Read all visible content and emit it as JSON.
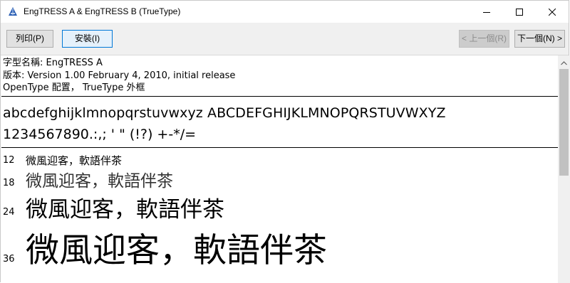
{
  "window": {
    "title": "EngTRESS A & EngTRESS B  (TrueType)",
    "icon": "font-file-icon",
    "controls": {
      "minimize": "minimize-icon",
      "maximize": "maximize-icon",
      "close": "close-icon"
    }
  },
  "toolbar": {
    "print_label": "列印(P)",
    "install_label": "安裝(I)",
    "prev_label": "< 上一個(R)",
    "next_label": "下一個(N) >"
  },
  "info": {
    "font_name": "字型名稱: EngTRESS A",
    "version": "版本: Version 1.00 February 4, 2010, initial release",
    "outline": "OpenType 配置， TrueType 外框"
  },
  "samples": {
    "alphabet": "abcdefghijklmnopqrstuvwxyz ABCDEFGHIJKLMNOPQRSTUVWXYZ",
    "numbers": "1234567890.:,; ' \" (!?) +-*/="
  },
  "size_samples": [
    {
      "size": "12",
      "text": "微風迎客，軟語伴茶"
    },
    {
      "size": "18",
      "text": "微風迎客，軟語伴茶"
    },
    {
      "size": "24",
      "text": "微風迎客，軟語伴茶"
    },
    {
      "size": "36",
      "text": "微風迎客，軟語伴茶"
    }
  ]
}
